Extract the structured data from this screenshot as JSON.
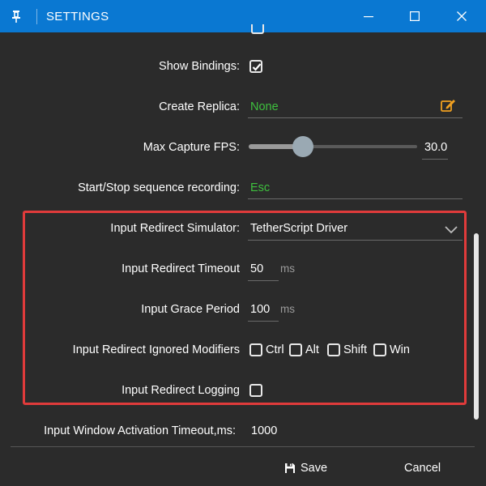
{
  "window": {
    "title": "SETTINGS"
  },
  "rows": {
    "show_bindings": {
      "label": "Show Bindings:",
      "checked": true
    },
    "create_replica": {
      "label": "Create Replica:",
      "value": "None"
    },
    "max_capture_fps": {
      "label": "Max Capture FPS:",
      "value": "30.0",
      "slider_fraction": 0.32
    },
    "sequence_recording": {
      "label": "Start/Stop sequence recording:",
      "value": "Esc"
    },
    "input_redirect_simulator": {
      "label": "Input Redirect Simulator:",
      "value": "TetherScript Driver"
    },
    "input_redirect_timeout": {
      "label": "Input Redirect Timeout",
      "value": "50",
      "unit": "ms"
    },
    "input_grace_period": {
      "label": "Input Grace Period",
      "value": "100",
      "unit": "ms"
    },
    "ignored_modifiers": {
      "label": "Input Redirect Ignored Modifiers",
      "options": [
        {
          "label": "Ctrl",
          "checked": false
        },
        {
          "label": "Alt",
          "checked": false
        },
        {
          "label": "Shift",
          "checked": false
        },
        {
          "label": "Win",
          "checked": false
        }
      ]
    },
    "input_redirect_logging": {
      "label": "Input Redirect Logging",
      "checked": false
    },
    "window_activation_timeout": {
      "label": "Input Window Activation Timeout,ms:",
      "value": "1000"
    }
  },
  "footer": {
    "save_label": "Save",
    "cancel_label": "Cancel"
  },
  "colors": {
    "titlebar": "#0a78d2",
    "background": "#2b2b2b",
    "highlight_value": "#3ec03e",
    "edit_icon": "#f0a020",
    "highlight_box": "#e03b3b"
  },
  "icons": {
    "pin": "pin-icon",
    "minimize": "minimize-icon",
    "maximize": "maximize-icon",
    "close": "close-icon",
    "edit": "edit-icon",
    "dropdown": "chevron-down-icon",
    "save": "floppy-disk-icon"
  }
}
